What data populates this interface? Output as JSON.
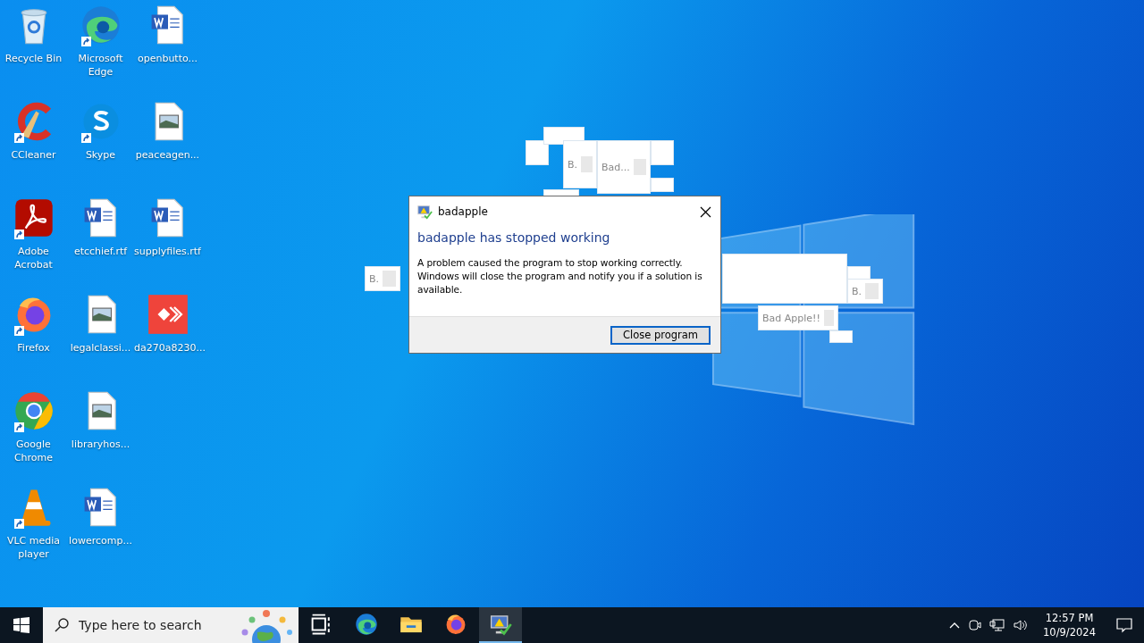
{
  "desktop_icons": [
    {
      "label": "Recycle Bin",
      "kind": "recycle",
      "shortcut": false
    },
    {
      "label": "CCleaner",
      "kind": "ccleaner",
      "shortcut": true
    },
    {
      "label": "Adobe Acrobat",
      "kind": "acrobat",
      "shortcut": true
    },
    {
      "label": "Firefox",
      "kind": "firefox",
      "shortcut": true
    },
    {
      "label": "Google Chrome",
      "kind": "chrome",
      "shortcut": true
    },
    {
      "label": "VLC media player",
      "kind": "vlc",
      "shortcut": true
    },
    {
      "label": "Microsoft Edge",
      "kind": "edge",
      "shortcut": true
    },
    {
      "label": "Skype",
      "kind": "skype",
      "shortcut": true
    },
    {
      "label": "etcchief.rtf",
      "kind": "word",
      "shortcut": false
    },
    {
      "label": "legalclassi...",
      "kind": "image",
      "shortcut": false
    },
    {
      "label": "libraryhos...",
      "kind": "image",
      "shortcut": false
    },
    {
      "label": "lowercomp...",
      "kind": "word",
      "shortcut": false
    },
    {
      "label": "openbutto...",
      "kind": "word",
      "shortcut": false
    },
    {
      "label": "peaceagen...",
      "kind": "image",
      "shortcut": false
    },
    {
      "label": "supplyfiles.rtf",
      "kind": "word",
      "shortcut": false
    },
    {
      "label": "da270a8230...",
      "kind": "app",
      "shortcut": false
    }
  ],
  "popups": [
    {
      "label": "B."
    },
    {
      "label": "Bad..."
    },
    {
      "label": "B."
    },
    {
      "label": "B."
    },
    {
      "label": "Bad Apple!!"
    }
  ],
  "dialog": {
    "title": "badapple",
    "heading": "badapple has stopped working",
    "message": "A problem caused the program to stop working correctly. Windows will close the program and notify you if a solution is available.",
    "button": "Close program"
  },
  "taskbar": {
    "search": {
      "placeholder": "Type here to search"
    },
    "apps": [
      {
        "kind": "taskview",
        "selected": false
      },
      {
        "kind": "edge",
        "selected": false
      },
      {
        "kind": "explorer",
        "selected": false
      },
      {
        "kind": "firefox",
        "selected": false
      },
      {
        "kind": "badapple",
        "selected": true
      }
    ],
    "time": "12:57 PM",
    "date": "10/9/2024"
  }
}
